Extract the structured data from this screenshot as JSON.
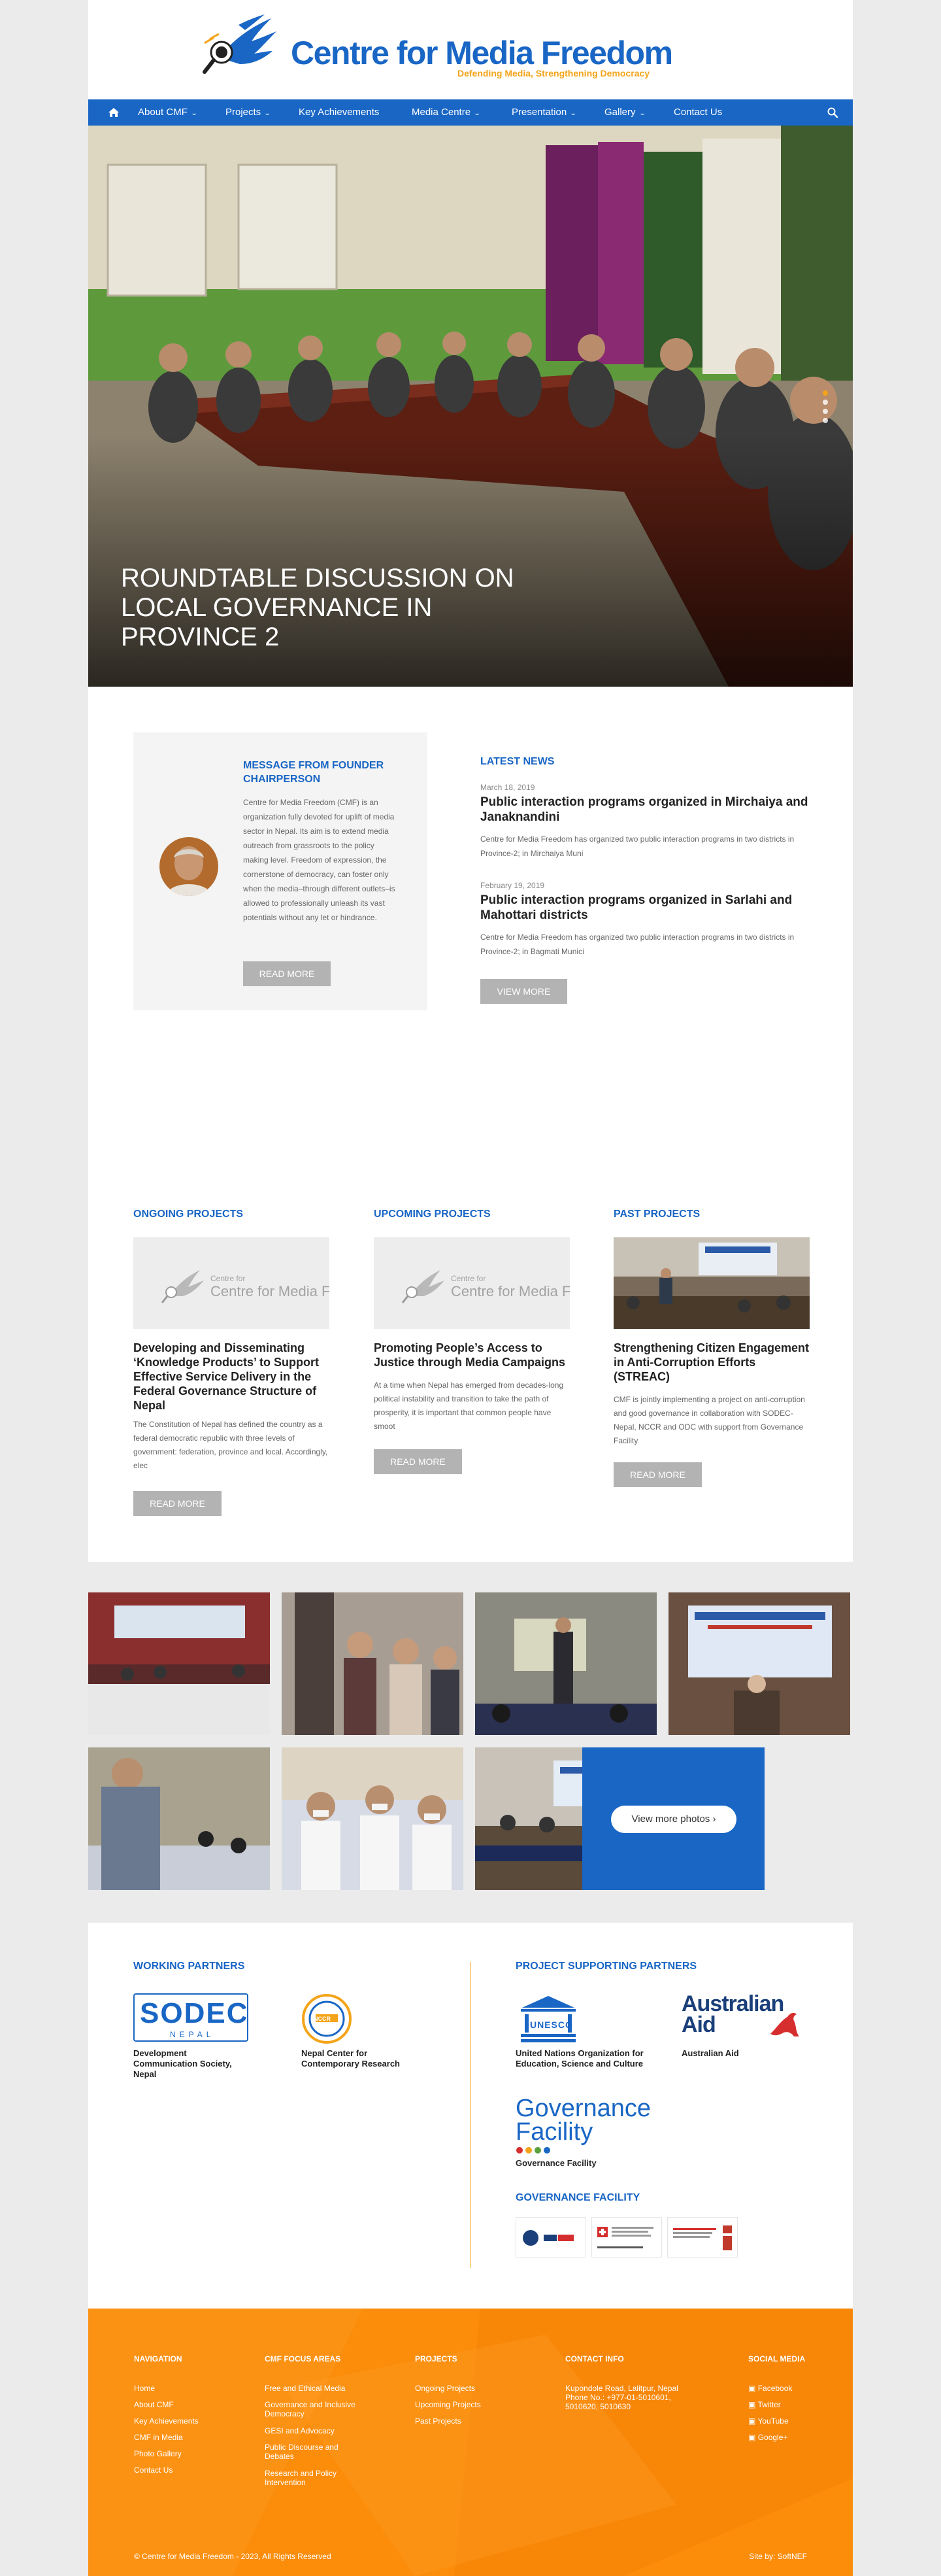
{
  "header": {
    "title": "Centre for Media Freedom",
    "tagline": "Defending Media, Strengthening Democracy"
  },
  "nav": {
    "items": [
      {
        "label": "About CMF",
        "dropdown": true
      },
      {
        "label": "Projects",
        "dropdown": true
      },
      {
        "label": "Key Achievements",
        "dropdown": false
      },
      {
        "label": "Media Centre",
        "dropdown": true
      },
      {
        "label": "Presentation",
        "dropdown": true
      },
      {
        "label": "Gallery",
        "dropdown": true
      },
      {
        "label": "Contact Us",
        "dropdown": false
      }
    ]
  },
  "hero": {
    "caption": "Roundtable Discussion on Local Governance in Province 2",
    "slide_count": 4,
    "active_slide": 1
  },
  "founder": {
    "title": "MESSAGE FROM FOUNDER CHAIRPERSON",
    "text": "Centre for Media Freedom (CMF) is an organization fully devoted for uplift of media sector in Nepal. Its aim is to extend media outreach from grassroots to the policy making level. Freedom of expression, the cornerstone of democracy, can foster only when the media–through different outlets–is allowed to professionally unleash its vast potentials without any let or hindrance.",
    "button": "READ MORE"
  },
  "news": {
    "heading": "LATEST NEWS",
    "items": [
      {
        "date": "March 18, 2019",
        "title": "Public interaction programs organized in Mirchaiya and Janaknandini",
        "text": "Centre for Media Freedom has organized two public interaction programs in two districts in Province-2; in Mirchaiya Muni"
      },
      {
        "date": "February 19, 2019",
        "title": "Public interaction programs organized in Sarlahi and Mahottari districts",
        "text": "Centre for Media Freedom has organized two public interaction programs in two districts in Province-2; in Bagmati Munici"
      }
    ],
    "button": "VIEW MORE"
  },
  "projects": [
    {
      "heading": "ONGOING PROJECTS",
      "placeholder_logo": "Centre for Media Freedom",
      "title": "Developing and Disseminating ‘Knowledge Products’ to Support Effective Service Delivery in the Federal Governance Structure of Nepal",
      "text": "The Constitution of Nepal has defined the country as a federal democratic republic with three levels of government: federation, province and local. Accordingly, elec",
      "button": "READ MORE"
    },
    {
      "heading": "UPCOMING PROJECTS",
      "placeholder_logo": "Centre for Media Freedom",
      "title": "Promoting People’s Access to Justice through Media Campaigns",
      "text": "At a time when Nepal has emerged from decades-long political instability and transition to take the path of prosperity, it is important that common people have smoot",
      "button": "READ MORE"
    },
    {
      "heading": "PAST PROJECTS",
      "title": "Strengthening Citizen Engagement in Anti-Corruption Efforts (STREAC)",
      "text": "CMF is jointly implementing a project on anti-corruption and good governance in collaboration with SODEC-Nepal, NCCR and ODC with support from Governance Facility",
      "button": "READ MORE"
    }
  ],
  "gallery": {
    "more_button": "View more photos"
  },
  "partners": {
    "working_heading": "WORKING PARTNERS",
    "working": [
      {
        "logo_text": "SODEC",
        "logo_sub": "NEPAL",
        "name": "Development Communication Society, Nepal"
      },
      {
        "logo_text": "NCCR",
        "name": "Nepal Center for Contemporary Research"
      }
    ],
    "supporting_heading": "PROJECT SUPPORTING PARTNERS",
    "supporting": [
      {
        "logo_text": "UNESCO",
        "name": "United Nations Organization for Education, Science and Culture"
      },
      {
        "logo_text": "Australian Aid",
        "name": "Australian Aid"
      },
      {
        "logo_text": "Governance Facility",
        "name": "Governance Facility"
      }
    ],
    "gov_heading": "GOVERNANCE FACILITY"
  },
  "footer": {
    "columns": [
      {
        "heading": "NAVIGATION",
        "items": [
          "Home",
          "About CMF",
          "Key Achievements",
          "CMF in Media",
          "Photo Gallery",
          "Contact Us"
        ]
      },
      {
        "heading": "CMF FOCUS AREAS",
        "items": [
          "Free and Ethical Media",
          "Governance and Inclusive Democracy",
          "GESI and Advocacy",
          "Public Discourse and Debates",
          "Research and Policy Intervention"
        ]
      },
      {
        "heading": "PROJECTS",
        "items": [
          "Ongoing Projects",
          "Upcoming Projects",
          "Past Projects"
        ]
      },
      {
        "heading": "CONTACT INFO",
        "items": [
          "Kupondole Road, Lalitpur, Nepal",
          "Phone No.: +977-01-5010601, 5010620, 5010630"
        ]
      },
      {
        "heading": "SOCIAL MEDIA",
        "items": [
          "Facebook",
          "Twitter",
          "YouTube",
          "Google+"
        ]
      }
    ],
    "copyright": "© Centre for Media Freedom - 2023, All Rights Reserved",
    "site_by": "Site by: SoftNEF"
  },
  "colors": {
    "brand_blue": "#1966c5",
    "accent_orange": "#f4a41a",
    "footer_orange": "#fb8d0b",
    "button_grey": "#b3b3b3"
  }
}
